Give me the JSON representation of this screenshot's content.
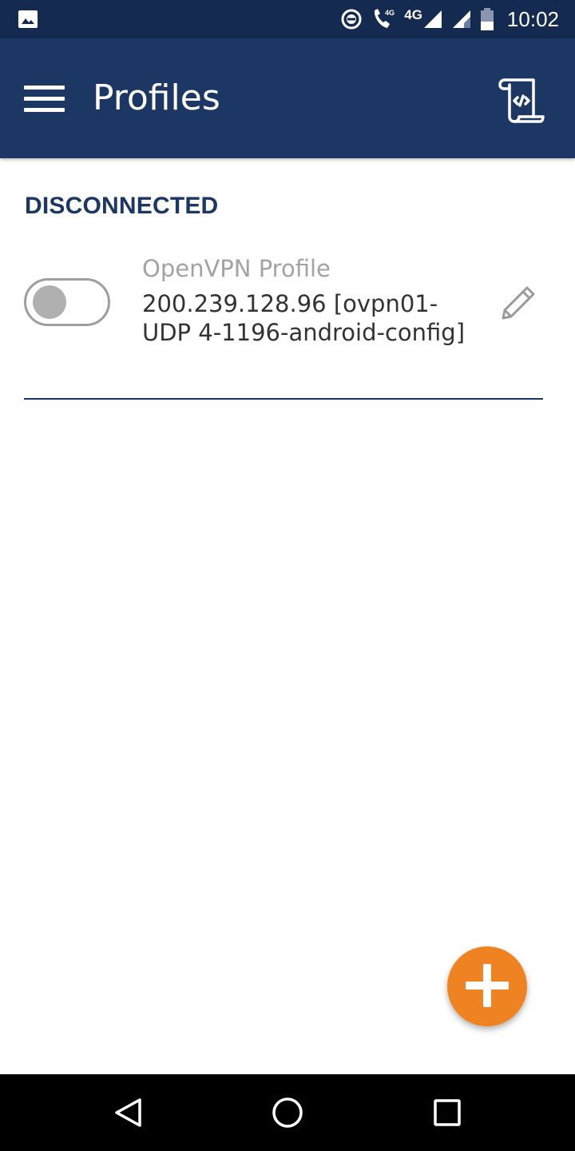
{
  "status_bar": {
    "network_label_1": "4G",
    "network_label_2": "4G",
    "time": "10:02",
    "icons": [
      "image-icon",
      "data-saver-icon",
      "wifi-calling-icon",
      "signal-icon",
      "signal-icon",
      "battery-icon"
    ]
  },
  "app_bar": {
    "title": "Profiles",
    "menu_icon": "hamburger-menu-icon",
    "import_icon": "import-profile-icon"
  },
  "connection": {
    "status": "DISCONNECTED"
  },
  "profiles": [
    {
      "name": "OpenVPN Profile",
      "detail": "200.239.128.96 [ovpn01-UDP 4-1196-android-config]",
      "connected": false
    }
  ],
  "fab": {
    "icon": "add-icon",
    "color": "#ef8322"
  },
  "colors": {
    "status_bar": "#142a50",
    "app_bar": "#1c3764",
    "accent": "#ef8322",
    "section_header": "#1c3764"
  },
  "nav_bar": {
    "icons": [
      "back-icon",
      "home-icon",
      "recents-icon"
    ]
  }
}
